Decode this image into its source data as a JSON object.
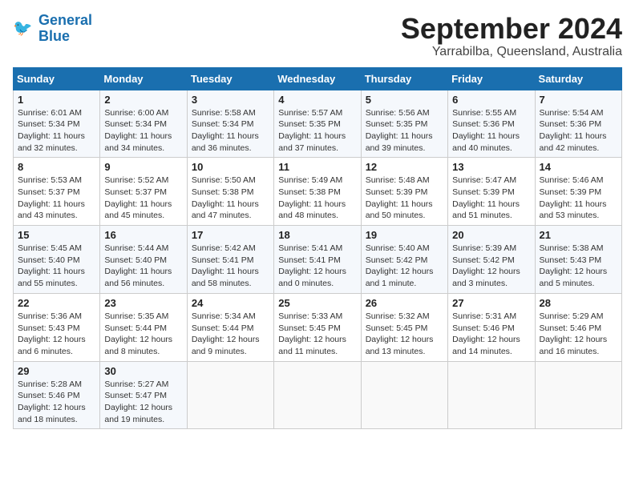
{
  "header": {
    "logo_line1": "General",
    "logo_line2": "Blue",
    "month_title": "September 2024",
    "location": "Yarrabilba, Queensland, Australia"
  },
  "weekdays": [
    "Sunday",
    "Monday",
    "Tuesday",
    "Wednesday",
    "Thursday",
    "Friday",
    "Saturday"
  ],
  "weeks": [
    [
      {
        "day": "1",
        "info": "Sunrise: 6:01 AM\nSunset: 5:34 PM\nDaylight: 11 hours\nand 32 minutes."
      },
      {
        "day": "2",
        "info": "Sunrise: 6:00 AM\nSunset: 5:34 PM\nDaylight: 11 hours\nand 34 minutes."
      },
      {
        "day": "3",
        "info": "Sunrise: 5:58 AM\nSunset: 5:34 PM\nDaylight: 11 hours\nand 36 minutes."
      },
      {
        "day": "4",
        "info": "Sunrise: 5:57 AM\nSunset: 5:35 PM\nDaylight: 11 hours\nand 37 minutes."
      },
      {
        "day": "5",
        "info": "Sunrise: 5:56 AM\nSunset: 5:35 PM\nDaylight: 11 hours\nand 39 minutes."
      },
      {
        "day": "6",
        "info": "Sunrise: 5:55 AM\nSunset: 5:36 PM\nDaylight: 11 hours\nand 40 minutes."
      },
      {
        "day": "7",
        "info": "Sunrise: 5:54 AM\nSunset: 5:36 PM\nDaylight: 11 hours\nand 42 minutes."
      }
    ],
    [
      {
        "day": "8",
        "info": "Sunrise: 5:53 AM\nSunset: 5:37 PM\nDaylight: 11 hours\nand 43 minutes."
      },
      {
        "day": "9",
        "info": "Sunrise: 5:52 AM\nSunset: 5:37 PM\nDaylight: 11 hours\nand 45 minutes."
      },
      {
        "day": "10",
        "info": "Sunrise: 5:50 AM\nSunset: 5:38 PM\nDaylight: 11 hours\nand 47 minutes."
      },
      {
        "day": "11",
        "info": "Sunrise: 5:49 AM\nSunset: 5:38 PM\nDaylight: 11 hours\nand 48 minutes."
      },
      {
        "day": "12",
        "info": "Sunrise: 5:48 AM\nSunset: 5:39 PM\nDaylight: 11 hours\nand 50 minutes."
      },
      {
        "day": "13",
        "info": "Sunrise: 5:47 AM\nSunset: 5:39 PM\nDaylight: 11 hours\nand 51 minutes."
      },
      {
        "day": "14",
        "info": "Sunrise: 5:46 AM\nSunset: 5:39 PM\nDaylight: 11 hours\nand 53 minutes."
      }
    ],
    [
      {
        "day": "15",
        "info": "Sunrise: 5:45 AM\nSunset: 5:40 PM\nDaylight: 11 hours\nand 55 minutes."
      },
      {
        "day": "16",
        "info": "Sunrise: 5:44 AM\nSunset: 5:40 PM\nDaylight: 11 hours\nand 56 minutes."
      },
      {
        "day": "17",
        "info": "Sunrise: 5:42 AM\nSunset: 5:41 PM\nDaylight: 11 hours\nand 58 minutes."
      },
      {
        "day": "18",
        "info": "Sunrise: 5:41 AM\nSunset: 5:41 PM\nDaylight: 12 hours\nand 0 minutes."
      },
      {
        "day": "19",
        "info": "Sunrise: 5:40 AM\nSunset: 5:42 PM\nDaylight: 12 hours\nand 1 minute."
      },
      {
        "day": "20",
        "info": "Sunrise: 5:39 AM\nSunset: 5:42 PM\nDaylight: 12 hours\nand 3 minutes."
      },
      {
        "day": "21",
        "info": "Sunrise: 5:38 AM\nSunset: 5:43 PM\nDaylight: 12 hours\nand 5 minutes."
      }
    ],
    [
      {
        "day": "22",
        "info": "Sunrise: 5:36 AM\nSunset: 5:43 PM\nDaylight: 12 hours\nand 6 minutes."
      },
      {
        "day": "23",
        "info": "Sunrise: 5:35 AM\nSunset: 5:44 PM\nDaylight: 12 hours\nand 8 minutes."
      },
      {
        "day": "24",
        "info": "Sunrise: 5:34 AM\nSunset: 5:44 PM\nDaylight: 12 hours\nand 9 minutes."
      },
      {
        "day": "25",
        "info": "Sunrise: 5:33 AM\nSunset: 5:45 PM\nDaylight: 12 hours\nand 11 minutes."
      },
      {
        "day": "26",
        "info": "Sunrise: 5:32 AM\nSunset: 5:45 PM\nDaylight: 12 hours\nand 13 minutes."
      },
      {
        "day": "27",
        "info": "Sunrise: 5:31 AM\nSunset: 5:46 PM\nDaylight: 12 hours\nand 14 minutes."
      },
      {
        "day": "28",
        "info": "Sunrise: 5:29 AM\nSunset: 5:46 PM\nDaylight: 12 hours\nand 16 minutes."
      }
    ],
    [
      {
        "day": "29",
        "info": "Sunrise: 5:28 AM\nSunset: 5:46 PM\nDaylight: 12 hours\nand 18 minutes."
      },
      {
        "day": "30",
        "info": "Sunrise: 5:27 AM\nSunset: 5:47 PM\nDaylight: 12 hours\nand 19 minutes."
      },
      {
        "day": "",
        "info": ""
      },
      {
        "day": "",
        "info": ""
      },
      {
        "day": "",
        "info": ""
      },
      {
        "day": "",
        "info": ""
      },
      {
        "day": "",
        "info": ""
      }
    ]
  ]
}
